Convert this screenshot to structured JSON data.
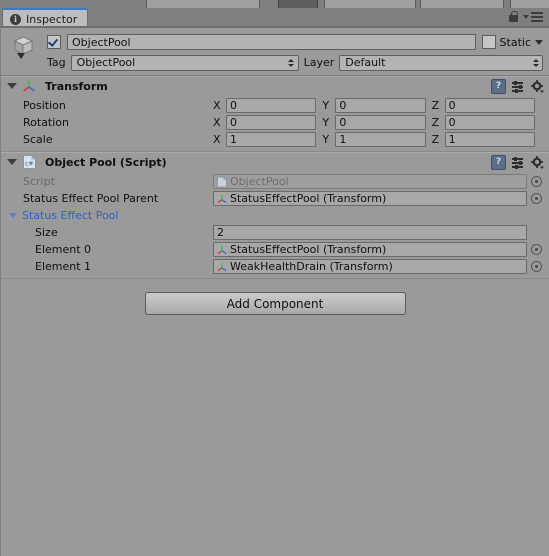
{
  "window": {
    "tab_label": "Inspector",
    "tab_icon": "info-icon",
    "lock_icon": "lock-icon",
    "menu_icon": "hamburger-menu-icon"
  },
  "object_header": {
    "icon": "gameobject-cube-icon",
    "enabled": true,
    "name": "ObjectPool",
    "static_label": "Static",
    "static_checked": false,
    "tag_label": "Tag",
    "tag_value": "ObjectPool",
    "layer_label": "Layer",
    "layer_value": "Default"
  },
  "components": [
    {
      "title": "Transform",
      "icon": "transform-axis-icon",
      "expanded": true,
      "header_icons": [
        "help-icon",
        "preset-icon",
        "gear-icon"
      ],
      "help_glyph": "?",
      "rows": [
        {
          "label": "Position",
          "axes": [
            "X",
            "Y",
            "Z"
          ],
          "values": [
            "0",
            "0",
            "0"
          ]
        },
        {
          "label": "Rotation",
          "axes": [
            "X",
            "Y",
            "Z"
          ],
          "values": [
            "0",
            "0",
            "0"
          ]
        },
        {
          "label": "Scale",
          "axes": [
            "X",
            "Y",
            "Z"
          ],
          "values": [
            "1",
            "1",
            "1"
          ]
        }
      ]
    },
    {
      "title": "Object Pool (Script)",
      "icon": "csharp-script-icon",
      "expanded": true,
      "header_icons": [
        "help-icon",
        "preset-icon",
        "gear-icon"
      ],
      "help_glyph": "?",
      "script_row": {
        "label": "Script",
        "value": "ObjectPool",
        "icon": "csharp-script-icon",
        "disabled": true
      },
      "object_row": {
        "label": "Status Effect Pool Parent",
        "value": "StatusEffectPool (Transform)",
        "icon": "transform-axis-icon"
      },
      "array": {
        "label": "Status Effect Pool",
        "expanded": true,
        "size_label": "Size",
        "size_value": "2",
        "elements": [
          {
            "label": "Element 0",
            "value": "StatusEffectPool (Transform)",
            "icon": "transform-axis-icon"
          },
          {
            "label": "Element 1",
            "value": "WeakHealthDrain (Transform)",
            "icon": "transform-axis-icon"
          }
        ]
      }
    }
  ],
  "footer": {
    "add_component_label": "Add Component"
  },
  "colors": {
    "panel_bg": "#9a9a9a",
    "chrome_bg": "#7f7f7f",
    "tab_bg": "#bdbdbd",
    "tab_accent": "#3a79c8",
    "field_bg": "#a8a8a8",
    "array_label": "#2f5fd0"
  }
}
